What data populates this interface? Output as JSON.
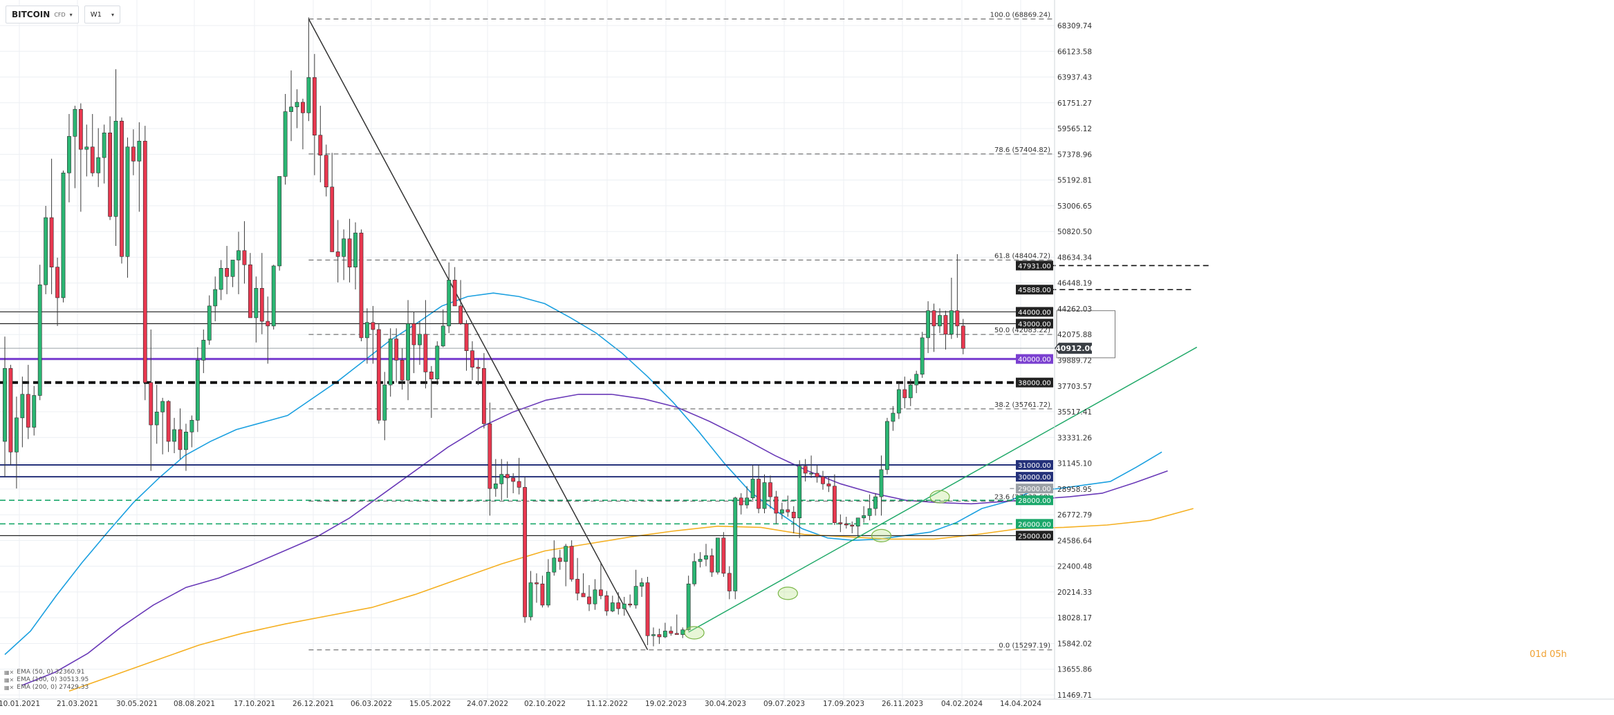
{
  "header": {
    "symbol": "BITCOIN",
    "symbol_type": "CFD",
    "timeframe": "W1"
  },
  "countdown": "01d 05h",
  "indicators": [
    {
      "label": "EMA (50, 0) 32360.91",
      "color": "#1ba0e0"
    },
    {
      "label": "EMA (100, 0) 30513.95",
      "color": "#6a3ab8"
    },
    {
      "label": "EMA (200, 0) 27429.33",
      "color": "#f5b022"
    }
  ],
  "chart_data": {
    "type": "candlestick",
    "x_ticks": [
      "10.01.2021",
      "21.03.2021",
      "30.05.2021",
      "08.08.2021",
      "17.10.2021",
      "26.12.2021",
      "06.03.2022",
      "15.05.2022",
      "24.07.2022",
      "02.10.2022",
      "11.12.2022",
      "19.02.2023",
      "30.04.2023",
      "09.07.2023",
      "17.09.2023",
      "26.11.2023",
      "04.02.2024",
      "14.04.2024"
    ],
    "y_ticks": [
      "68309.74",
      "66123.58",
      "63937.43",
      "61751.27",
      "59565.12",
      "57378.96",
      "55192.81",
      "53006.65",
      "50820.50",
      "48634.34",
      "46448.19",
      "44262.03",
      "42075.88",
      "39889.72",
      "37703.57",
      "35517.41",
      "33331.26",
      "31145.10",
      "28958.95",
      "26772.79",
      "24586.64",
      "22400.48",
      "20214.33",
      "18028.17",
      "15842.02",
      "13655.86",
      "11469.71"
    ],
    "ylim": [
      11469.71,
      68309.74
    ],
    "up_color": "#2bb673",
    "down_color": "#e8384f",
    "current_price": "40912.00",
    "ohlc": [
      [
        33000,
        41900,
        30000,
        39200
      ],
      [
        39200,
        39500,
        31000,
        32100
      ],
      [
        32100,
        36800,
        29000,
        35000
      ],
      [
        35000,
        38500,
        32500,
        37000
      ],
      [
        37000,
        39500,
        33200,
        34200
      ],
      [
        34200,
        37700,
        33500,
        36900
      ],
      [
        36900,
        48000,
        36500,
        46300
      ],
      [
        46300,
        53000,
        45500,
        52000
      ],
      [
        52000,
        57000,
        45500,
        47800
      ],
      [
        47800,
        48600,
        42800,
        45200
      ],
      [
        45200,
        56000,
        44800,
        55800
      ],
      [
        55800,
        60800,
        53300,
        58900
      ],
      [
        58900,
        61500,
        54500,
        61200
      ],
      [
        61200,
        61700,
        52500,
        57800
      ],
      [
        57800,
        59900,
        55500,
        58000
      ],
      [
        58000,
        60800,
        55500,
        55800
      ],
      [
        55800,
        59600,
        54600,
        57100
      ],
      [
        57100,
        59900,
        54900,
        59200
      ],
      [
        59200,
        60600,
        51800,
        52100
      ],
      [
        52100,
        64600,
        49600,
        60200
      ],
      [
        60200,
        60500,
        48100,
        48700
      ],
      [
        48700,
        58800,
        46900,
        58000
      ],
      [
        58000,
        59500,
        55600,
        56800
      ],
      [
        56800,
        60100,
        52500,
        58500
      ],
      [
        58500,
        59800,
        36500,
        38000
      ],
      [
        38000,
        42500,
        30500,
        34400
      ],
      [
        34400,
        37800,
        32800,
        35500
      ],
      [
        35500,
        36700,
        31900,
        36400
      ],
      [
        36400,
        36500,
        32100,
        33000
      ],
      [
        33000,
        35000,
        32000,
        34000
      ],
      [
        34000,
        35800,
        31500,
        32300
      ],
      [
        32300,
        34500,
        30500,
        33800
      ],
      [
        33800,
        35200,
        32500,
        34800
      ],
      [
        34800,
        41000,
        33800,
        39900
      ],
      [
        39900,
        42500,
        38800,
        41600
      ],
      [
        41600,
        45400,
        41200,
        44500
      ],
      [
        44500,
        47000,
        43200,
        45900
      ],
      [
        45900,
        48400,
        45000,
        47700
      ],
      [
        47700,
        49600,
        45500,
        47000
      ],
      [
        47000,
        48200,
        46100,
        48400
      ],
      [
        48400,
        50800,
        45500,
        49200
      ],
      [
        49200,
        51700,
        46400,
        48000
      ],
      [
        48000,
        49000,
        44300,
        43500
      ],
      [
        43500,
        47000,
        41400,
        46000
      ],
      [
        46000,
        49000,
        42100,
        43200
      ],
      [
        43200,
        45300,
        39600,
        42800
      ],
      [
        42800,
        48000,
        42500,
        47900
      ],
      [
        47900,
        52500,
        47500,
        55500
      ],
      [
        55500,
        62500,
        54800,
        61000
      ],
      [
        61000,
        64500,
        58500,
        61400
      ],
      [
        61400,
        62900,
        59600,
        61800
      ],
      [
        61800,
        62100,
        57800,
        60900
      ],
      [
        60900,
        69000,
        60200,
        63900
      ],
      [
        63900,
        65900,
        55600,
        59000
      ],
      [
        59000,
        61500,
        55000,
        57300
      ],
      [
        57300,
        58200,
        53800,
        54600
      ],
      [
        54600,
        57500,
        49500,
        49100
      ],
      [
        49100,
        51800,
        46500,
        48700
      ],
      [
        48700,
        51000,
        46700,
        50200
      ],
      [
        50200,
        51900,
        46500,
        47800
      ],
      [
        47800,
        51600,
        45900,
        50700
      ],
      [
        50700,
        51000,
        41500,
        41800
      ],
      [
        41800,
        44300,
        39600,
        43100
      ],
      [
        43100,
        44500,
        39600,
        42500
      ],
      [
        42500,
        43000,
        34500,
        34800
      ],
      [
        34800,
        38900,
        33100,
        37800
      ],
      [
        37800,
        42600,
        36800,
        41700
      ],
      [
        41700,
        42600,
        38000,
        39900
      ],
      [
        39900,
        40900,
        37400,
        38200
      ],
      [
        38200,
        45000,
        36500,
        43000
      ],
      [
        43000,
        44000,
        38800,
        41200
      ],
      [
        41200,
        43200,
        39500,
        42100
      ],
      [
        42100,
        45000,
        37500,
        38900
      ],
      [
        38900,
        39400,
        35000,
        38300
      ],
      [
        38300,
        41500,
        37800,
        41100
      ],
      [
        41100,
        44200,
        41000,
        42800
      ],
      [
        42800,
        48200,
        42200,
        46700
      ],
      [
        46700,
        47800,
        45100,
        44500
      ],
      [
        44500,
        46700,
        42900,
        43000
      ],
      [
        43000,
        43300,
        39000,
        40700
      ],
      [
        40700,
        41500,
        38200,
        39300
      ],
      [
        39300,
        40000,
        37800,
        39200
      ],
      [
        39200,
        40500,
        34100,
        34500
      ],
      [
        34500,
        36300,
        26700,
        29000
      ],
      [
        29000,
        31500,
        28300,
        29400
      ],
      [
        29400,
        31500,
        28000,
        30200
      ],
      [
        30200,
        31300,
        28200,
        29900
      ],
      [
        29900,
        30300,
        28600,
        29600
      ],
      [
        29600,
        31600,
        28500,
        29100
      ],
      [
        29100,
        30000,
        17600,
        18100
      ],
      [
        18100,
        22000,
        17800,
        21000
      ],
      [
        21000,
        21800,
        19300,
        20900
      ],
      [
        20900,
        21600,
        18900,
        19100
      ],
      [
        19100,
        23000,
        18900,
        21900
      ],
      [
        21900,
        24600,
        21600,
        23100
      ],
      [
        23100,
        23800,
        22100,
        22800
      ],
      [
        22800,
        24300,
        20700,
        24100
      ],
      [
        24100,
        24600,
        21100,
        21300
      ],
      [
        21300,
        23100,
        19500,
        20100
      ],
      [
        20100,
        21800,
        19800,
        19800
      ],
      [
        19800,
        20800,
        18600,
        19200
      ],
      [
        19200,
        21300,
        18700,
        20400
      ],
      [
        20400,
        22700,
        19600,
        19900
      ],
      [
        19900,
        20300,
        18200,
        18600
      ],
      [
        18600,
        19900,
        18500,
        19300
      ],
      [
        19300,
        20200,
        18300,
        18800
      ],
      [
        18800,
        19800,
        18200,
        19200
      ],
      [
        19200,
        20000,
        18900,
        19100
      ],
      [
        19100,
        22100,
        18800,
        20700
      ],
      [
        20700,
        21400,
        19800,
        21000
      ],
      [
        21000,
        21500,
        15700,
        16500
      ],
      [
        16500,
        17200,
        15600,
        16600
      ],
      [
        16600,
        17100,
        15800,
        16400
      ],
      [
        16400,
        17600,
        16300,
        16900
      ],
      [
        16900,
        17300,
        16500,
        16700
      ],
      [
        16700,
        18300,
        16700,
        16600
      ],
      [
        16600,
        17200,
        16300,
        17000
      ],
      [
        17000,
        21600,
        16900,
        20900
      ],
      [
        20900,
        23500,
        20700,
        22800
      ],
      [
        22800,
        23600,
        22300,
        23000
      ],
      [
        23000,
        24300,
        22400,
        23300
      ],
      [
        23300,
        23900,
        21500,
        21900
      ],
      [
        21900,
        24800,
        21700,
        24800
      ],
      [
        24800,
        25300,
        21500,
        21800
      ],
      [
        21800,
        22400,
        19600,
        20300
      ],
      [
        20300,
        28300,
        19600,
        28200
      ],
      [
        28200,
        28600,
        26800,
        27600
      ],
      [
        27600,
        29200,
        27300,
        28200
      ],
      [
        28200,
        31000,
        28000,
        29800
      ],
      [
        29800,
        31000,
        26900,
        27300
      ],
      [
        27300,
        30200,
        26900,
        29500
      ],
      [
        29500,
        30100,
        27300,
        28300
      ],
      [
        28300,
        28800,
        26000,
        26900
      ],
      [
        26900,
        27800,
        26400,
        27200
      ],
      [
        27200,
        28400,
        26600,
        27000
      ],
      [
        27000,
        27500,
        25200,
        26500
      ],
      [
        26500,
        31400,
        24800,
        30900
      ],
      [
        30900,
        31500,
        29600,
        30300
      ],
      [
        30300,
        31800,
        29900,
        30300
      ],
      [
        30300,
        31000,
        29500,
        30000
      ],
      [
        30000,
        30500,
        28900,
        29400
      ],
      [
        29400,
        30000,
        28700,
        29200
      ],
      [
        29200,
        30200,
        25900,
        26100
      ],
      [
        26100,
        26800,
        25300,
        26000
      ],
      [
        26000,
        26600,
        25600,
        25900
      ],
      [
        25900,
        26200,
        25200,
        25800
      ],
      [
        25800,
        26500,
        24900,
        26500
      ],
      [
        26500,
        27500,
        26100,
        26700
      ],
      [
        26700,
        28500,
        26300,
        27300
      ],
      [
        27300,
        28600,
        26700,
        28300
      ],
      [
        28300,
        31800,
        26700,
        30600
      ],
      [
        30600,
        35000,
        30200,
        34700
      ],
      [
        34700,
        36000,
        33900,
        35400
      ],
      [
        35400,
        38000,
        34900,
        37400
      ],
      [
        37400,
        38500,
        35800,
        36700
      ],
      [
        36700,
        38300,
        36000,
        37800
      ],
      [
        37800,
        39000,
        37100,
        38700
      ],
      [
        38700,
        42300,
        38400,
        41800
      ],
      [
        41800,
        44900,
        40500,
        44100
      ],
      [
        44100,
        44700,
        40600,
        42800
      ],
      [
        42800,
        44300,
        42200,
        43700
      ],
      [
        43700,
        44100,
        40800,
        42100
      ],
      [
        42100,
        46900,
        41700,
        44100
      ],
      [
        44100,
        48900,
        41800,
        42800
      ],
      [
        42800,
        43400,
        40400,
        40900
      ]
    ],
    "ema_series": [
      {
        "name": "EMA (50, 0) 32360.91",
        "start_index": 0,
        "color": "#1ba0e0",
        "values": [
          14900,
          16900,
          19900,
          22700,
          25300,
          27800,
          29900,
          31800,
          33000,
          34000,
          34600,
          35200,
          36700,
          38200,
          39900,
          41600,
          43000,
          44500,
          45300,
          45600,
          45300,
          44700,
          43500,
          42200,
          40500,
          38500,
          36300,
          33800,
          31100,
          28700,
          27100,
          25600,
          24800,
          24600,
          24700,
          25000,
          25300,
          26100,
          27300,
          27900,
          28800,
          29000,
          29300,
          29600,
          30800,
          32100
        ]
      },
      {
        "name": "EMA (100, 0) 30513.95",
        "start_index": 3,
        "color": "#6a3ab8",
        "values": [
          12300,
          13400,
          15000,
          17200,
          19100,
          20600,
          21400,
          22500,
          23700,
          24900,
          26500,
          28500,
          30500,
          32500,
          34200,
          35500,
          36500,
          37000,
          37000,
          36600,
          35900,
          34700,
          33300,
          31800,
          30500,
          29400,
          28600,
          28000,
          27800,
          27700,
          27900,
          28100,
          28300,
          28600,
          29500,
          30500
        ]
      },
      {
        "name": "EMA (200, 0) 27429.33",
        "start_index": 11,
        "color": "#f5b022",
        "values": [
          11800,
          13100,
          14400,
          15700,
          16700,
          17500,
          18200,
          18900,
          20000,
          21300,
          22600,
          23700,
          24300,
          24900,
          25400,
          25800,
          25700,
          25100,
          24900,
          24700,
          24700,
          25100,
          25600,
          25700,
          25900,
          26300,
          27300
        ]
      }
    ],
    "horizontal_levels": [
      {
        "price": "47931.00",
        "style": "dash-short"
      },
      {
        "price": "45888.00",
        "style": "dash-short"
      },
      {
        "price": "44000.00",
        "style": "solid-black"
      },
      {
        "price": "43000.00",
        "style": "solid-black"
      },
      {
        "price": "40000.00",
        "style": "solid-purple"
      },
      {
        "price": "38000.00",
        "style": "dash-thick"
      },
      {
        "price": "31000.00",
        "style": "solid-navy"
      },
      {
        "price": "30000.00",
        "style": "solid-navy"
      },
      {
        "price": "29000.00",
        "style": "dash-gray"
      },
      {
        "price": "28000.00",
        "style": "dash-green"
      },
      {
        "price": "26000.00",
        "style": "dash-green"
      },
      {
        "price": "25000.00",
        "style": "solid-black"
      }
    ],
    "fibonacci": [
      {
        "label": "100.0 (68869.24)",
        "price": 68869.24
      },
      {
        "label": "78.6 (57404.82)",
        "price": 57404.82
      },
      {
        "label": "61.8 (48404.72)",
        "price": 48404.72
      },
      {
        "label": "50.0 (42083.22)",
        "price": 42083.22
      },
      {
        "label": "38.2 (35761.72)",
        "price": 35761.72
      },
      {
        "label": "23.6 (27932.60)",
        "price": 27932.6
      },
      {
        "label": "0.0 (15297.19)",
        "price": 15297.19
      }
    ],
    "trend_lines": [
      {
        "from": [
          52,
          68869
        ],
        "to": [
          110,
          15300
        ],
        "color": "#333333"
      },
      {
        "from": [
          117,
          16800
        ],
        "to": [
          204,
          41000
        ],
        "color": "#22aa6a"
      }
    ],
    "circled_points": [
      {
        "index": 118,
        "price": 16750
      },
      {
        "index": 134,
        "price": 20100
      },
      {
        "index": 150,
        "price": 25000
      },
      {
        "index": 160,
        "price": 28300
      }
    ],
    "highlight_box": {
      "from_index": 180,
      "to_index": 190,
      "high": 44100,
      "low": 40100
    }
  }
}
